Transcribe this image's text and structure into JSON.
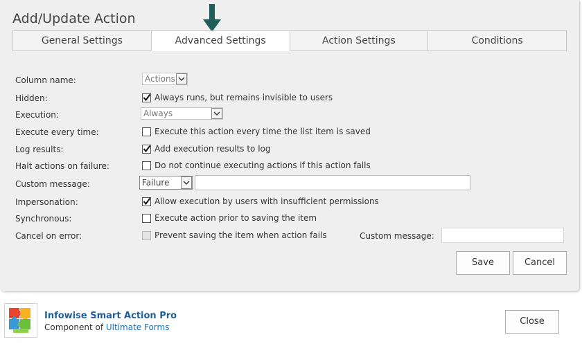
{
  "dialog": {
    "title": "Add/Update Action"
  },
  "tabs": [
    {
      "label": "General Settings"
    },
    {
      "label": "Advanced Settings",
      "active": true
    },
    {
      "label": "Action Settings"
    },
    {
      "label": "Conditions"
    }
  ],
  "form": {
    "column_name": {
      "label": "Column name:",
      "value": "Actions"
    },
    "hidden": {
      "label": "Hidden:",
      "checked": true,
      "text": "Always runs, but remains invisible to users"
    },
    "execution": {
      "label": "Execution:",
      "value": "Always"
    },
    "execute_every_time": {
      "label": "Execute every time:",
      "checked": false,
      "text": "Execute this action every time the list item is saved"
    },
    "log_results": {
      "label": "Log results:",
      "checked": true,
      "text": "Add execution results to log"
    },
    "halt_on_failure": {
      "label": "Halt actions on failure:",
      "checked": false,
      "text": "Do not continue executing actions if this action fails"
    },
    "custom_message": {
      "label": "Custom message:",
      "select_value": "Failure",
      "text_value": ""
    },
    "impersonation": {
      "label": "Impersonation:",
      "checked": true,
      "text": "Allow execution by users with insufficient permissions"
    },
    "synchronous": {
      "label": "Synchronous:",
      "checked": false,
      "text": "Execute action prior to saving the item"
    },
    "cancel_on_error": {
      "label": "Cancel on error:",
      "checked": false,
      "disabled": true,
      "text": "Prevent saving the item when action fails",
      "message_label": "Custom message:",
      "message_value": ""
    }
  },
  "buttons": {
    "save": "Save",
    "cancel": "Cancel",
    "close": "Close"
  },
  "footer": {
    "product": "Infowise Smart Action Pro",
    "component_prefix": "Component of ",
    "component_link": "Ultimate Forms"
  },
  "colors": {
    "accent_arrow": "#1f5e58",
    "link": "#1e6fb5",
    "panel_bg": "#efefef"
  }
}
